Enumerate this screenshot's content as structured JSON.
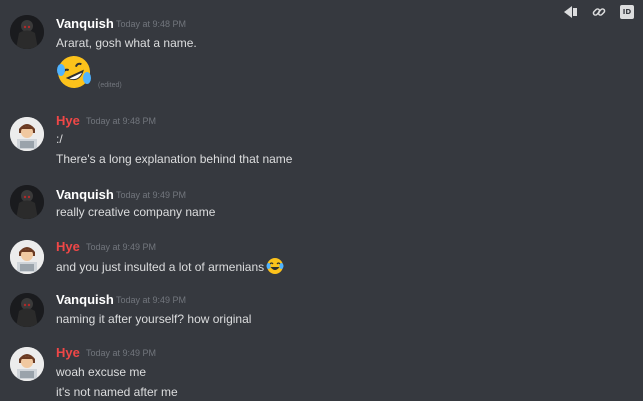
{
  "toolbar": {
    "icons": [
      "pin-icon",
      "link-icon",
      "id-icon"
    ],
    "id_label": "ID"
  },
  "messages": [
    {
      "author": "Vanquish",
      "author_color": "#ffffff",
      "timestamp": "Today at 9:48 PM",
      "lines": [
        "Ararat, gosh what a name."
      ],
      "emoji": "rolling-on-floor-laughing",
      "edited_label": "(edited)"
    },
    {
      "author": "Hye",
      "author_color": "#f04747",
      "timestamp": "Today at 9:48 PM",
      "lines": [
        ":/",
        "There's a long explanation behind that name"
      ]
    },
    {
      "author": "Vanquish",
      "author_color": "#ffffff",
      "timestamp": "Today at 9:49 PM",
      "lines": [
        "really creative company name"
      ]
    },
    {
      "author": "Hye",
      "author_color": "#f04747",
      "timestamp": "Today at 9:49 PM",
      "lines": [
        "and you just insulted a lot of armenians"
      ],
      "inline_emoji": "joy"
    },
    {
      "author": "Vanquish",
      "author_color": "#ffffff",
      "timestamp": "Today at 9:49 PM",
      "lines": [
        "naming it after yourself? how original"
      ]
    },
    {
      "author": "Hye",
      "author_color": "#f04747",
      "timestamp": "Today at 9:49 PM",
      "lines": [
        "woah excuse me",
        "it's not named after me"
      ]
    }
  ],
  "colors": {
    "background": "#36393f",
    "text": "#dcddde",
    "timestamp": "#72767d"
  }
}
